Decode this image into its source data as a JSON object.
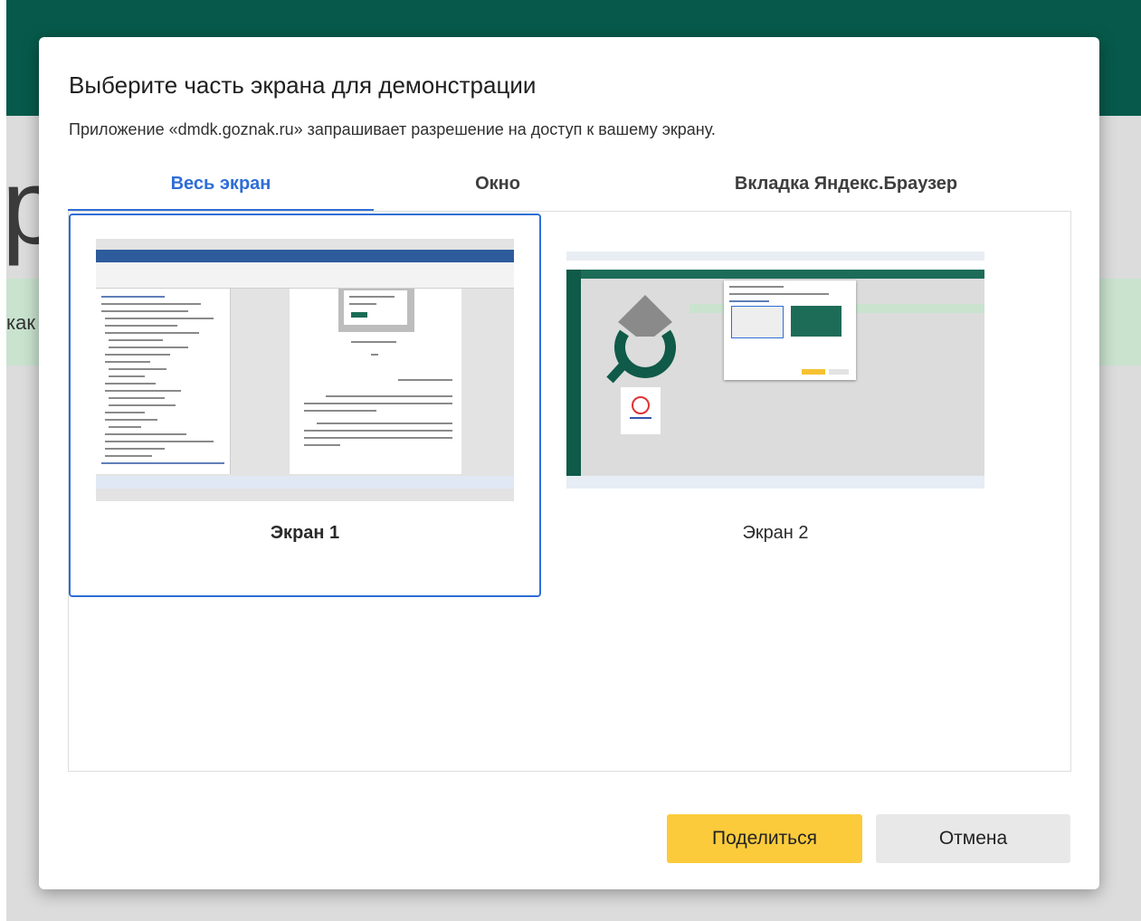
{
  "background": {
    "big_letter": "р",
    "fragment_text": "как"
  },
  "dialog": {
    "title": "Выберите часть экрана для демонстрации",
    "description": "Приложение «dmdk.goznak.ru» запрашивает разрешение на доступ к вашему экрану.",
    "tabs": [
      {
        "label": "Весь экран",
        "active": true
      },
      {
        "label": "Окно",
        "active": false
      },
      {
        "label": "Вкладка Яндекс.Браузер",
        "active": false
      }
    ],
    "screens": [
      {
        "label": "Экран 1",
        "selected": true
      },
      {
        "label": "Экран 2",
        "selected": false
      }
    ],
    "buttons": {
      "share": "Поделиться",
      "cancel": "Отмена"
    }
  },
  "colors": {
    "header_green": "#075a4b",
    "accent_blue": "#2f6ed6",
    "share_yellow": "#fbcb3c"
  }
}
